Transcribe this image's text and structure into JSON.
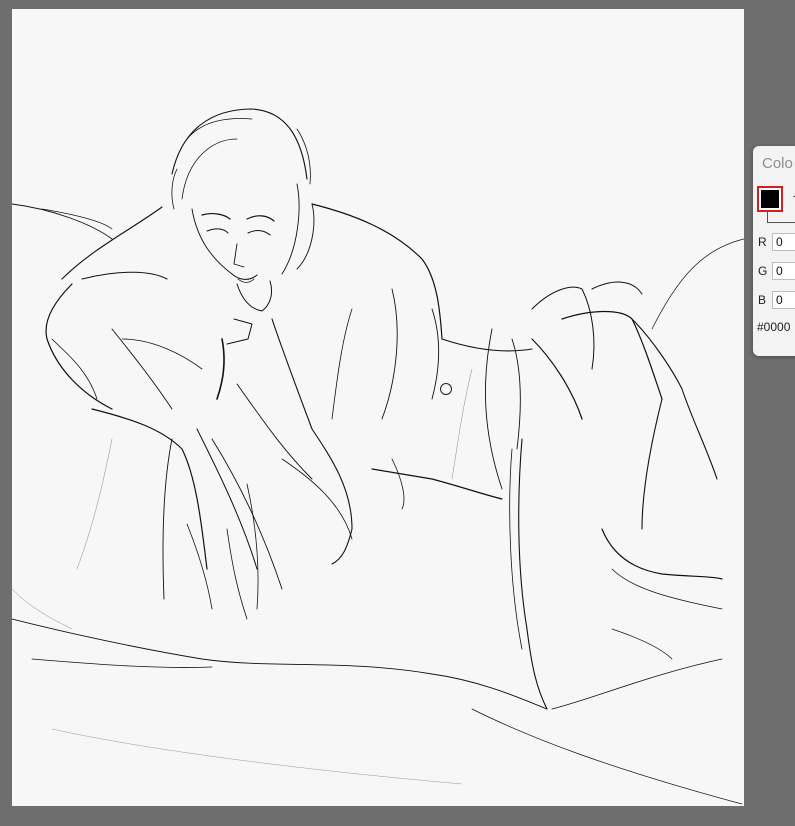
{
  "canvas": {
    "background": "#f7f7f7",
    "stroke_color": "#111111"
  },
  "color_panel": {
    "title": "Colo",
    "current_color": "#000000",
    "swatch_border": "#d21f1f",
    "channels": [
      {
        "label": "R",
        "value": "0"
      },
      {
        "label": "G",
        "value": "0"
      },
      {
        "label": "B",
        "value": "0"
      }
    ],
    "hex": "#0000"
  },
  "cursor_icon": "brush-circle-icon"
}
